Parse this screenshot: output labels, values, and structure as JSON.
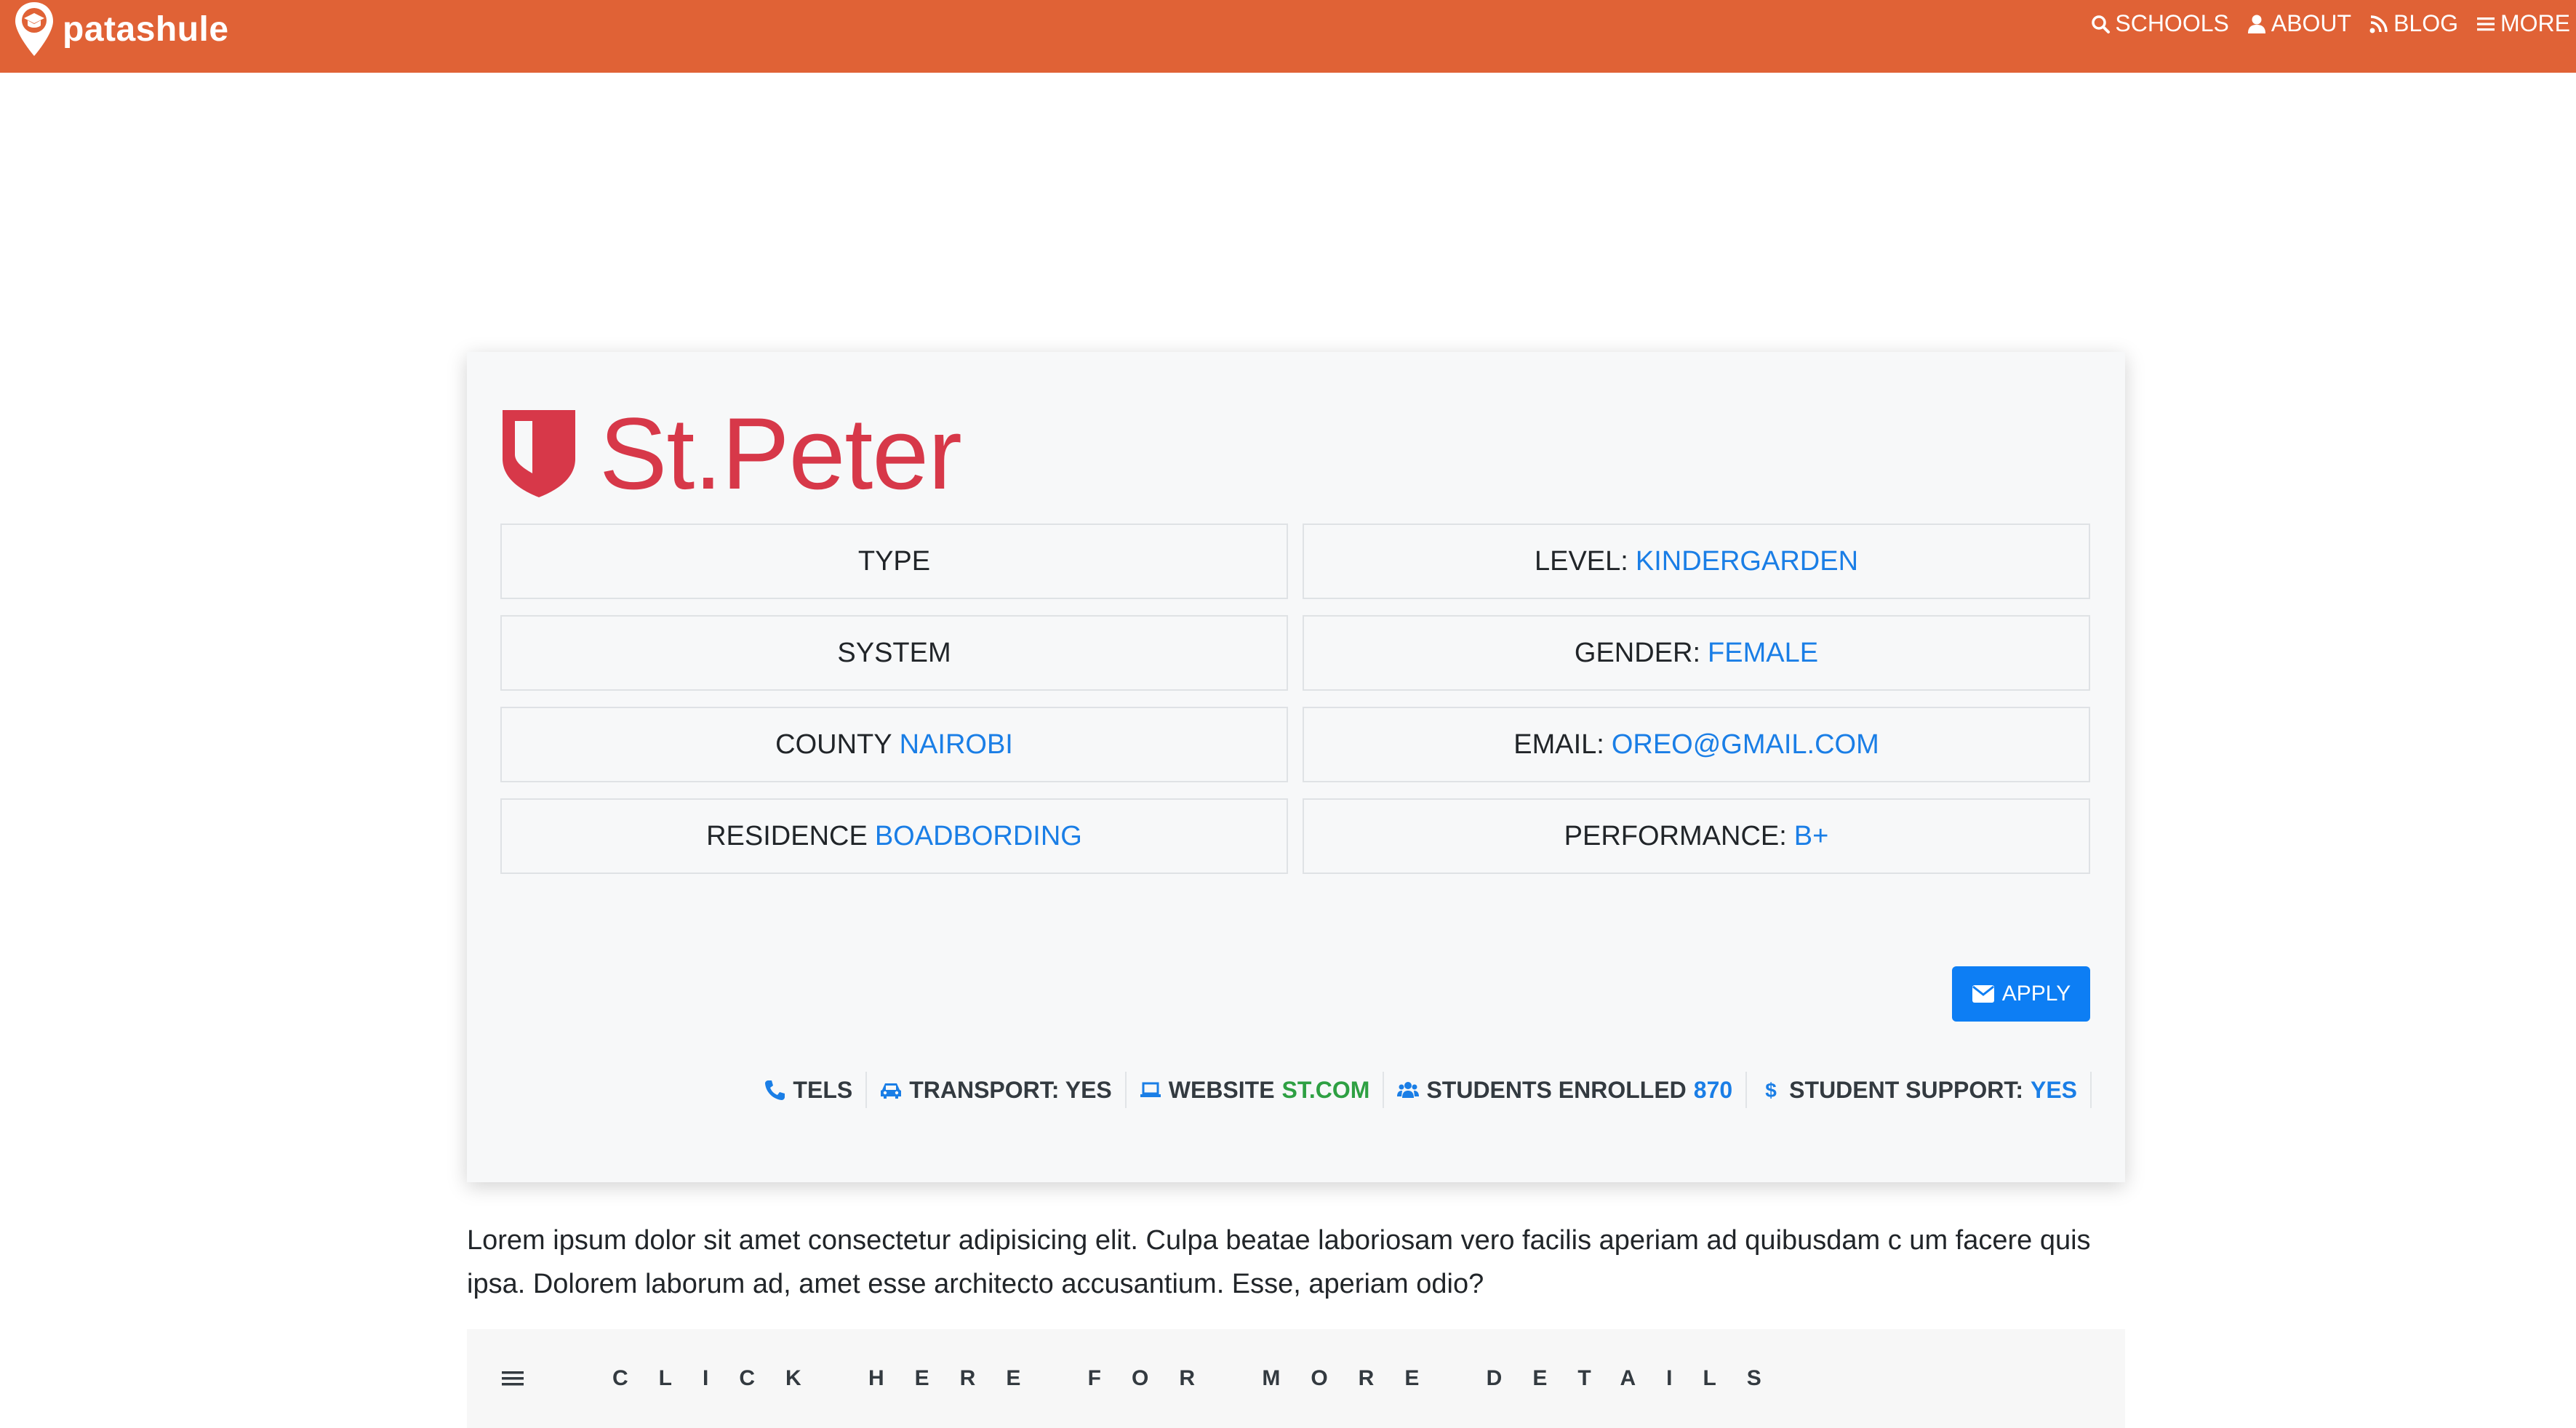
{
  "brand": {
    "name": "patashule"
  },
  "nav": {
    "items": [
      {
        "label": "SCHOOLS",
        "icon": "search-icon"
      },
      {
        "label": "ABOUT",
        "icon": "user-icon"
      },
      {
        "label": "BLOG",
        "icon": "rss-icon"
      },
      {
        "label": "MORE",
        "icon": "bars-icon"
      }
    ]
  },
  "school": {
    "name": "St.Peter",
    "icon": "shield-icon",
    "fields": {
      "type": {
        "label": "TYPE",
        "value": ""
      },
      "level": {
        "label": "LEVEL:",
        "value": "KINDERGARDEN"
      },
      "system": {
        "label": "SYSTEM",
        "value": ""
      },
      "gender": {
        "label": "GENDER:",
        "value": "FEMALE"
      },
      "county": {
        "label": "COUNTY",
        "value": "NAIROBI"
      },
      "email": {
        "label": "EMAIL:",
        "value": "OREO@GMAIL.COM"
      },
      "residence": {
        "label": "RESIDENCE",
        "value": "BOADBORDING"
      },
      "performance": {
        "label": "PERFORMANCE:",
        "value": "B+"
      }
    },
    "apply_label": "APPLY",
    "info": {
      "tels": {
        "label": "TELS",
        "icon": "phone-icon"
      },
      "transport": {
        "label": "TRANSPORT: YES",
        "icon": "car-icon"
      },
      "website": {
        "label": "WEBSITE",
        "value": "ST.COM",
        "icon": "laptop-icon"
      },
      "students": {
        "label": "STUDENTS ENROLLED",
        "value": "870",
        "icon": "users-icon"
      },
      "support": {
        "label": "STUDENT SUPPORT:",
        "value": "YES",
        "icon": "dollar-icon"
      }
    }
  },
  "description": "Lorem ipsum dolor sit amet consectetur adipisicing elit. Culpa beatae laboriosam vero facilis aperiam ad quibusdam c um facere quis ipsa. Dolorem laborum ad, amet esse architecto accusantium. Esse, aperiam odio?",
  "details": {
    "label": "CLICK HERE FOR MORE DETAILS"
  },
  "colors": {
    "navbar": "#e06236",
    "brand_red": "#d73849",
    "link_blue": "#1a7ee6",
    "button_blue": "#0d7ef4",
    "green": "#2ea043"
  }
}
